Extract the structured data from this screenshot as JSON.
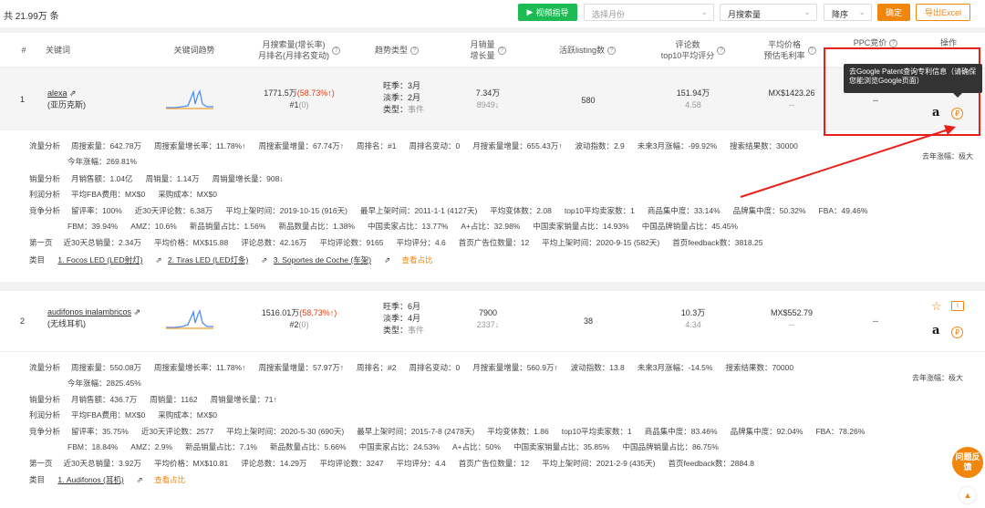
{
  "toolbar": {
    "total": "共 21.99万 条",
    "video_btn": "视频指导",
    "month_placeholder": "选择月份",
    "sort_field": "月搜索量",
    "sort_order": "降序",
    "confirm": "确定",
    "export": "导出Excel"
  },
  "headers": {
    "num": "#",
    "keyword": "关键词",
    "trend": "关键词趋势",
    "search_l1": "月搜索量(增长率)",
    "search_l2": "月排名(月排名变动)",
    "trend_type": "趋势类型",
    "sales_l1": "月销量",
    "sales_l2": "增长量",
    "listing": "活跃listing数",
    "review_l1": "评论数",
    "review_l2": "top10平均评分",
    "price_l1": "平均价格",
    "price_l2": "预估毛利率",
    "ppc": "PPC竞价",
    "action": "操作"
  },
  "tooltip": "去Google Patent查询专利信息（请确保您能浏览Google页面）",
  "rows": [
    {
      "num": "1",
      "keyword": "alexa",
      "keyword_cn": "(亚历克斯)",
      "search": "1771.5万",
      "growth": "(58.73%↑)",
      "rank": "#1",
      "rank_change": "(0)",
      "peak": "旺季：3月",
      "off": "淡季：2月",
      "type_label": "类型：",
      "type": "事件",
      "sales": "7.34万",
      "sales_growth": "8949↓",
      "listing": "580",
      "reviews": "151.94万",
      "rating": "4.58",
      "price": "MX$1423.26",
      "margin": "--",
      "ppc": "--",
      "detail": {
        "flow_label": "流量分析",
        "flow": [
          "周搜索量：642.78万",
          "周搜索量增长率：11.78%↑",
          "周搜索量增量：67.74万↑",
          "周排名：#1",
          "周排名变动：0",
          "月搜索量增量：655.43万↑",
          "波动指数：2.9",
          "未来3月涨幅：-99.92%",
          "搜索结果数：30000",
          "去年涨幅：极大"
        ],
        "flow2": "今年涨幅：269.81%",
        "sales_label": "销量分析",
        "sales": [
          "月销售额：1.04亿",
          "周销量：1.14万",
          "周销量增长量：908↓"
        ],
        "profit_label": "利润分析",
        "profit": [
          "平均FBA费用：MX$0",
          "采购成本：MX$0"
        ],
        "comp_label": "竞争分析",
        "comp": [
          "留评率：100%",
          "近30天评论数：6.38万",
          "平均上架时间：2019-10-15 (916天)",
          "最早上架时间：2011-1-1 (4127天)",
          "平均变体数：2.08",
          "top10平均卖家数：1",
          "商品集中度：33.14%",
          "品牌集中度：50.32%",
          "FBA：49.46%"
        ],
        "comp2": [
          "FBM：39.94%",
          "AMZ：10.6%",
          "新品销量占比：1.56%",
          "新品数量占比：1.38%",
          "中国卖家占比：13.77%",
          "A+占比：32.98%",
          "中国卖家销量占比：14.93%",
          "中国品牌销量占比：45.45%"
        ],
        "page1_label": "第一页",
        "page1": [
          "近30天总销量：2.34万",
          "平均价格：MX$15.88",
          "评论总数：42.16万",
          "平均评论数：9165",
          "平均评分：4.6",
          "首页广告位数量：12",
          "平均上架时间：2020-9-15 (582天)",
          "首页feedback数：3818.25"
        ],
        "cat_label": "类目",
        "cats": [
          "1. Focos LED (LED射灯)",
          "2. Tiras LED (LED灯条)",
          "3. Soportes de Coche (车架)"
        ],
        "see": "查看占比"
      }
    },
    {
      "num": "2",
      "keyword": "audifonos inalambricos",
      "keyword_cn": "(无线耳机)",
      "search": "1516.01万",
      "growth": "(58.73%↑)",
      "rank": "#2",
      "rank_change": "(0)",
      "peak": "旺季：6月",
      "off": "淡季：4月",
      "type_label": "类型：",
      "type": "事件",
      "sales": "7900",
      "sales_growth": "2337↓",
      "listing": "38",
      "reviews": "10.3万",
      "rating": "4.34",
      "price": "MX$552.79",
      "margin": "--",
      "ppc": "--",
      "detail": {
        "flow_label": "流量分析",
        "flow": [
          "周搜索量：550.08万",
          "周搜索量增长率：11.78%↑",
          "周搜索量增量：57.97万↑",
          "周排名：#2",
          "周排名变动：0",
          "月搜索量增量：560.9万↑",
          "波动指数：13.8",
          "未来3月涨幅：-14.5%",
          "搜索结果数：70000",
          "去年涨幅：极大"
        ],
        "flow2": "今年涨幅：2825.45%",
        "sales_label": "销量分析",
        "sales": [
          "月销售额：436.7万",
          "周销量：1162",
          "周销量增长量：71↑"
        ],
        "profit_label": "利润分析",
        "profit": [
          "平均FBA费用：MX$0",
          "采购成本：MX$0"
        ],
        "comp_label": "竞争分析",
        "comp": [
          "留评率：35.75%",
          "近30天评论数：2577",
          "平均上架时间：2020-5-30 (690天)",
          "最早上架时间：2015-7-8 (2478天)",
          "平均变体数：1.86",
          "top10平均卖家数：1",
          "商品集中度：83.46%",
          "品牌集中度：92.04%",
          "FBA：78.26%"
        ],
        "comp2": [
          "FBM：18.84%",
          "AMZ：2.9%",
          "新品销量占比：7.1%",
          "新品数量占比：5.66%",
          "中国卖家占比：24.53%",
          "A+占比：50%",
          "中国卖家销量占比：35.85%",
          "中国品牌销量占比：86.75%"
        ],
        "page1_label": "第一页",
        "page1": [
          "近30天总销量：3.92万",
          "平均价格：MX$10.81",
          "评论总数：14.29万",
          "平均评论数：3247",
          "平均评分：4.4",
          "首页广告位数量：12",
          "平均上架时间：2021-2-9 (435天)",
          "首页feedback数：2884.8"
        ],
        "cat_label": "类目",
        "cats": [
          "1. Audifonos (耳机)"
        ],
        "see": "查看占比"
      }
    }
  ],
  "feedback": "问题反馈",
  "colors": {
    "accent": "#f0860d",
    "green": "#1eba53",
    "red": "#e8201a"
  }
}
